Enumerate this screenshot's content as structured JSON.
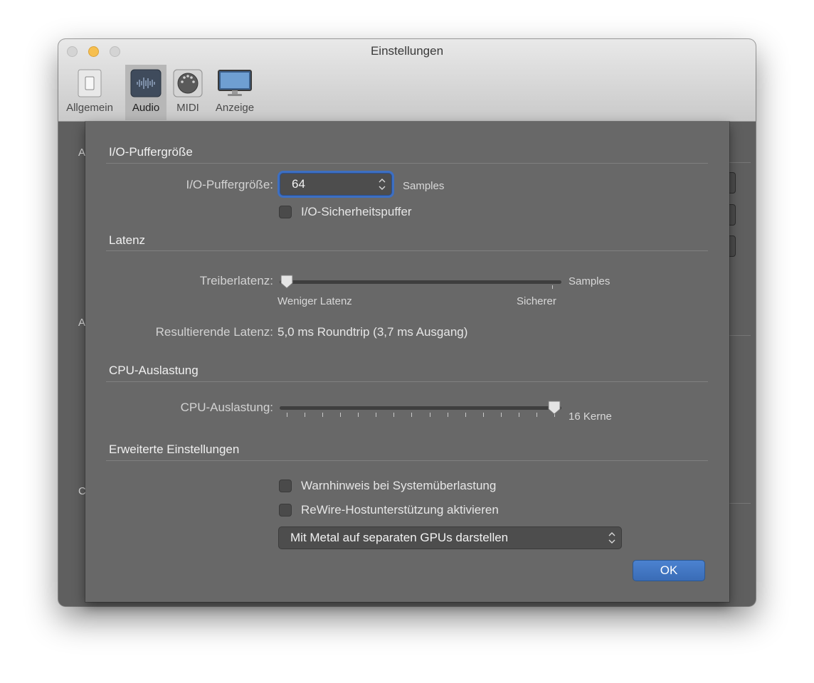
{
  "window": {
    "title": "Einstellungen",
    "tabs": [
      {
        "label": "Allgemein",
        "icon": "switch-icon"
      },
      {
        "label": "Audio",
        "icon": "waveform-icon"
      },
      {
        "label": "MIDI",
        "icon": "midi-connector-icon"
      },
      {
        "label": "Anzeige",
        "icon": "display-icon"
      }
    ],
    "active_tab": "Audio"
  },
  "background_clipped_letters": [
    "A",
    "A",
    "C"
  ],
  "sheet": {
    "io_section": {
      "title": "I/O-Puffergröße",
      "buffer_label": "I/O-Puffergröße:",
      "buffer_value": "64",
      "buffer_unit": "Samples",
      "safety_buffer_label": "I/O-Sicherheitspuffer",
      "safety_buffer_checked": false
    },
    "latency_section": {
      "title": "Latenz",
      "driver_latency_label": "Treiberlatenz:",
      "driver_latency_unit": "Samples",
      "driver_latency_position": 0.0,
      "min_label": "Weniger Latenz",
      "max_label": "Sicherer",
      "resulting_label": "Resultierende Latenz:",
      "resulting_value": "5,0 ms Roundtrip (3,7 ms Ausgang)"
    },
    "cpu_section": {
      "title": "CPU-Auslastung",
      "cpu_label": "CPU-Auslastung:",
      "cpu_value_label": "16 Kerne",
      "cpu_slider_position": 1.0,
      "tick_count": 16
    },
    "advanced_section": {
      "title": "Erweiterte Einstellungen",
      "overload_warning_label": "Warnhinweis bei Systemüberlastung",
      "overload_warning_checked": false,
      "rewire_label": "ReWire-Hostunterstützung aktivieren",
      "rewire_checked": false,
      "metal_popup_value": "Mit Metal auf separaten GPUs darstellen"
    },
    "ok_label": "OK"
  },
  "colors": {
    "accent": "#3d6fc2",
    "ok_button": "#4377c4",
    "window_background": "#5f5f5f",
    "sheet_background": "#686868"
  }
}
